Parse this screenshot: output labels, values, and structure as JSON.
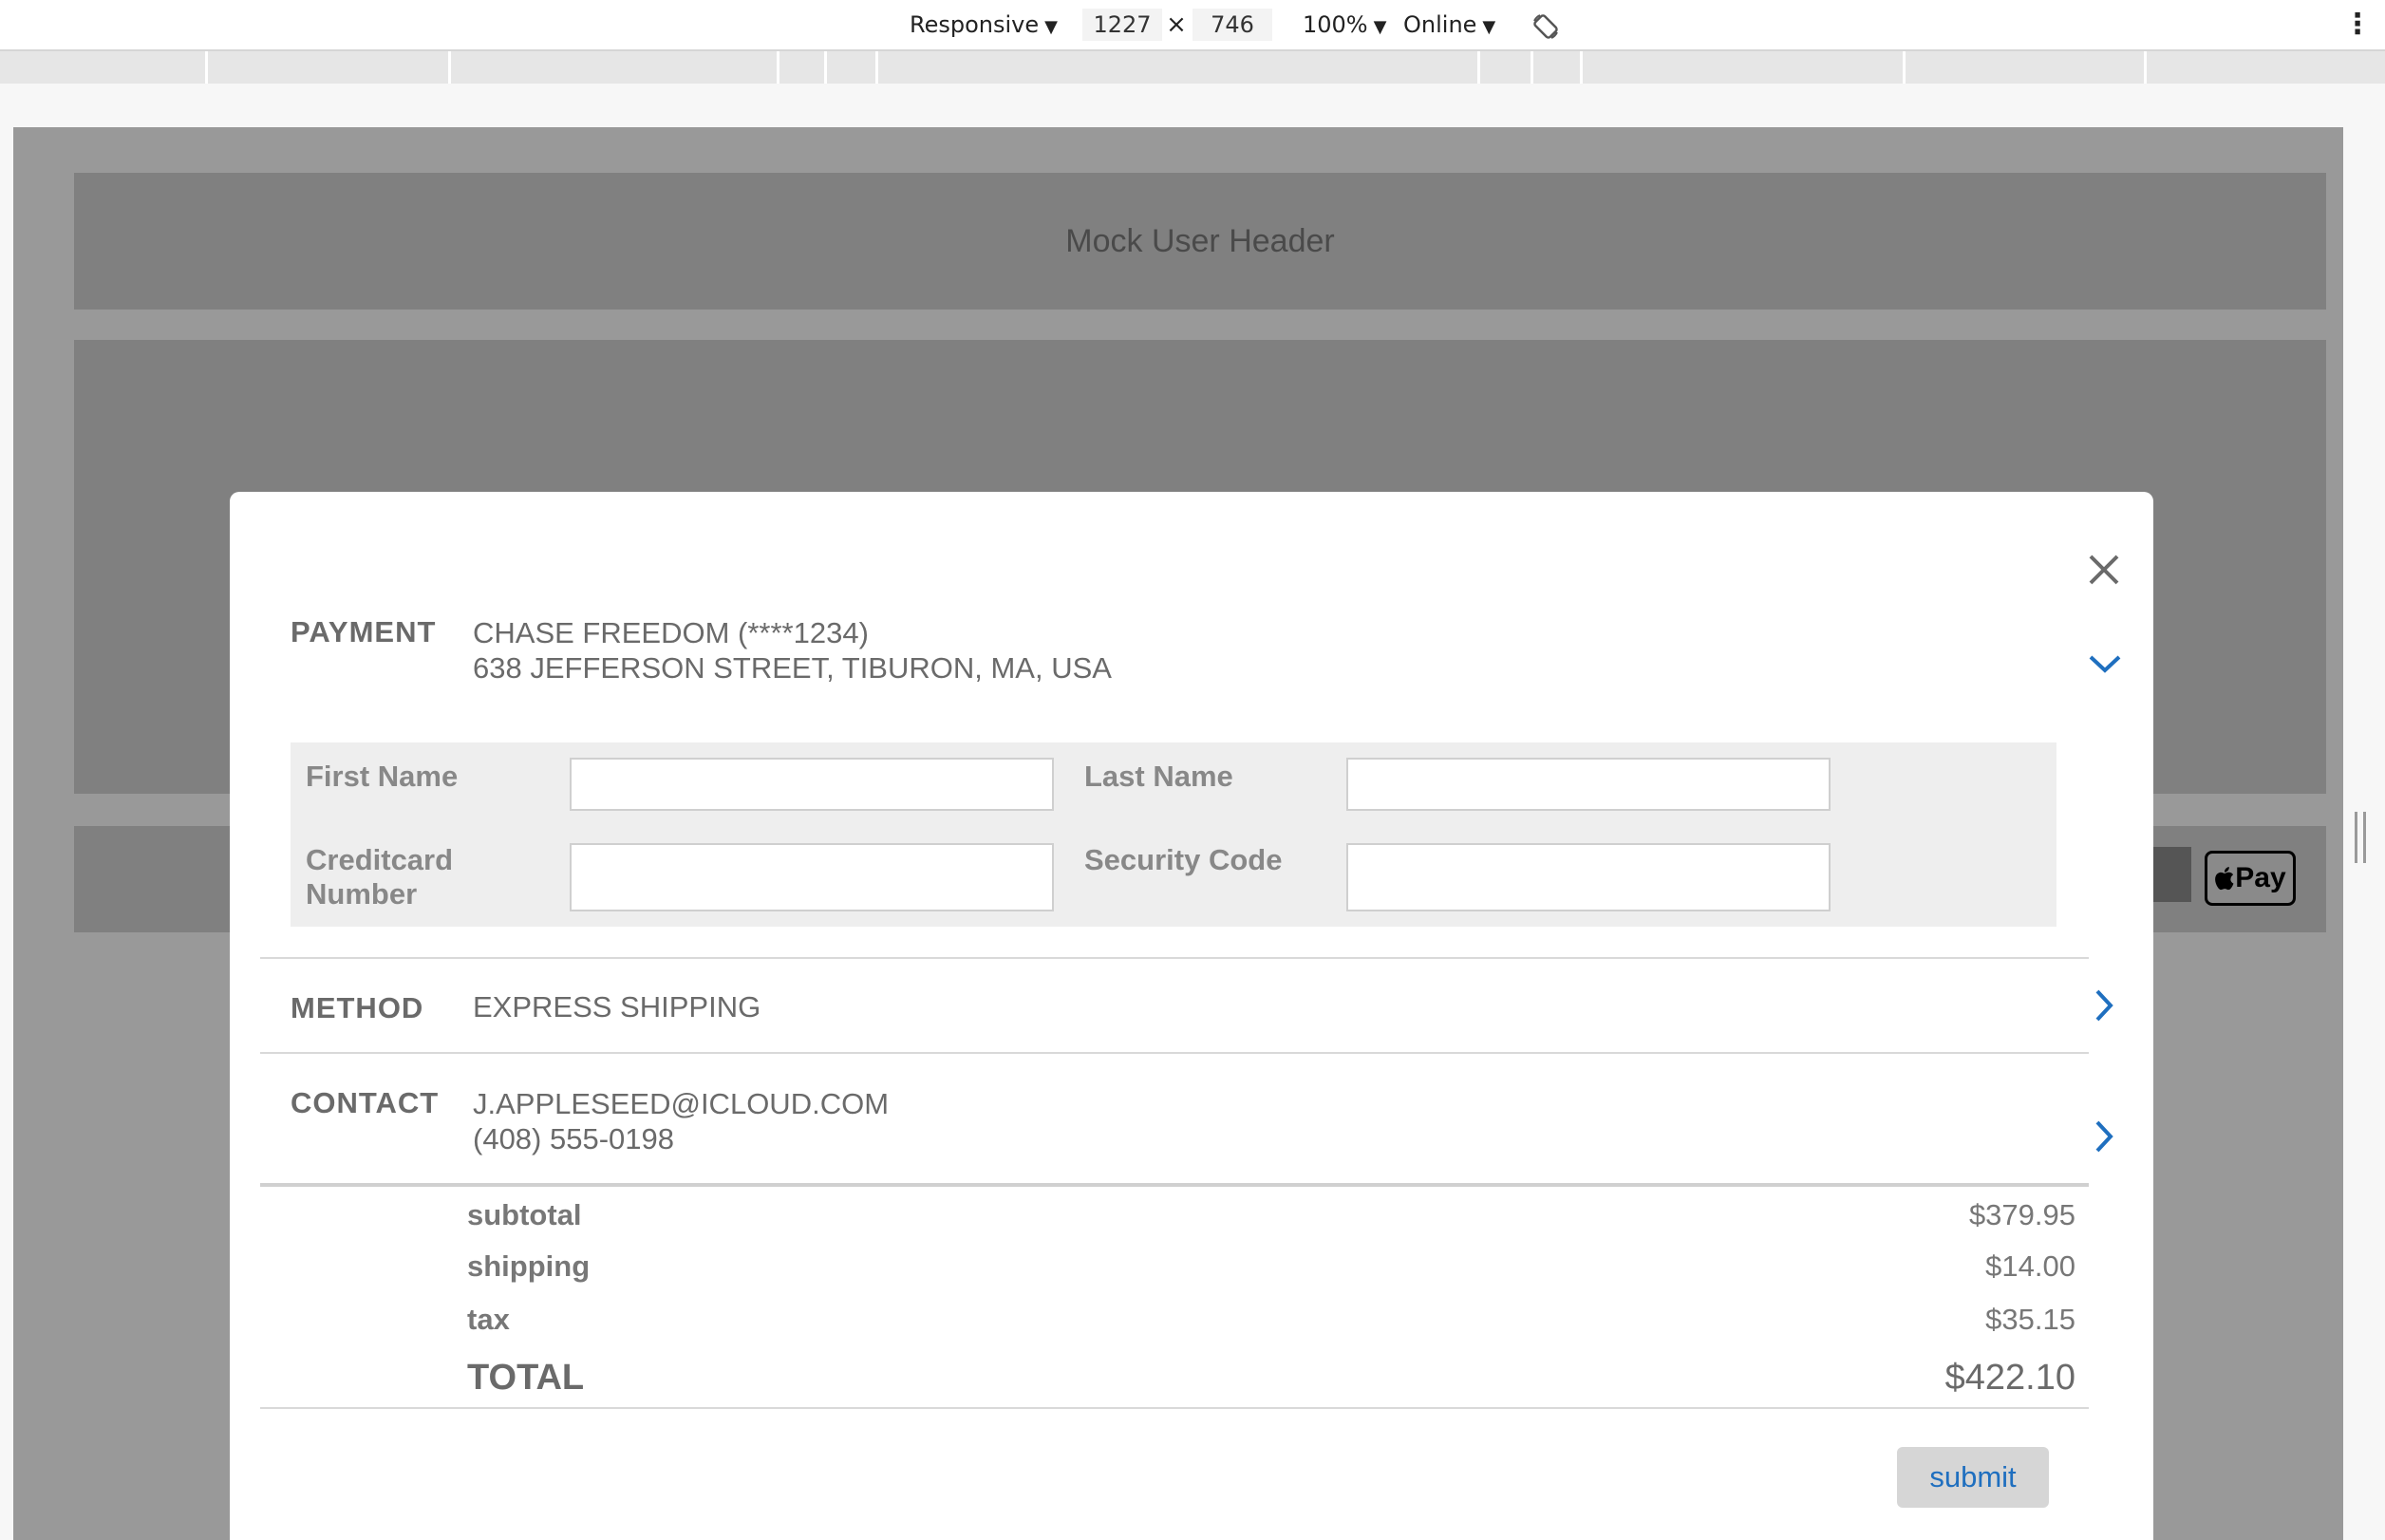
{
  "devtools": {
    "device": "Responsive",
    "width": "1227",
    "height": "746",
    "zoom": "100%",
    "network": "Online",
    "times_sign": "×",
    "caret": "▼",
    "more": "⋮"
  },
  "page": {
    "header_text": "Mock User Header",
    "apple_pay_label": "Pay"
  },
  "modal": {
    "payment": {
      "label": "PAYMENT",
      "card": "CHASE FREEDOM (****1234)",
      "address": "638 JEFFERSON STREET, TIBURON, MA, USA"
    },
    "form": {
      "first_name_label": "First Name",
      "first_name_value": "",
      "last_name_label": "Last Name",
      "last_name_value": "",
      "card_number_label_line1": "Creditcard",
      "card_number_label_line2": "Number",
      "card_number_value": "",
      "security_code_label": "Security Code",
      "security_code_value": ""
    },
    "method": {
      "label": "METHOD",
      "value": "EXPRESS SHIPPING"
    },
    "contact": {
      "label": "CONTACT",
      "email": "J.APPLESEED@ICLOUD.COM",
      "phone": "(408) 555-0198"
    },
    "summary": {
      "subtotal_label": "subtotal",
      "subtotal_value": "$379.95",
      "shipping_label": "shipping",
      "shipping_value": "$14.00",
      "tax_label": "tax",
      "tax_value": "$35.15",
      "total_label": "TOTAL",
      "total_value": "$422.10"
    },
    "submit_label": "submit"
  },
  "colors": {
    "accent": "#1f6fbf",
    "overlay": "#999999",
    "mock_block": "#808080",
    "text": "#6a6a6a"
  },
  "icons": {
    "close": "close-icon",
    "expand": "chevron-down-icon",
    "next": "chevron-right-icon",
    "rotate": "rotate-icon",
    "apple": "apple-icon",
    "more": "more-vertical-icon"
  }
}
